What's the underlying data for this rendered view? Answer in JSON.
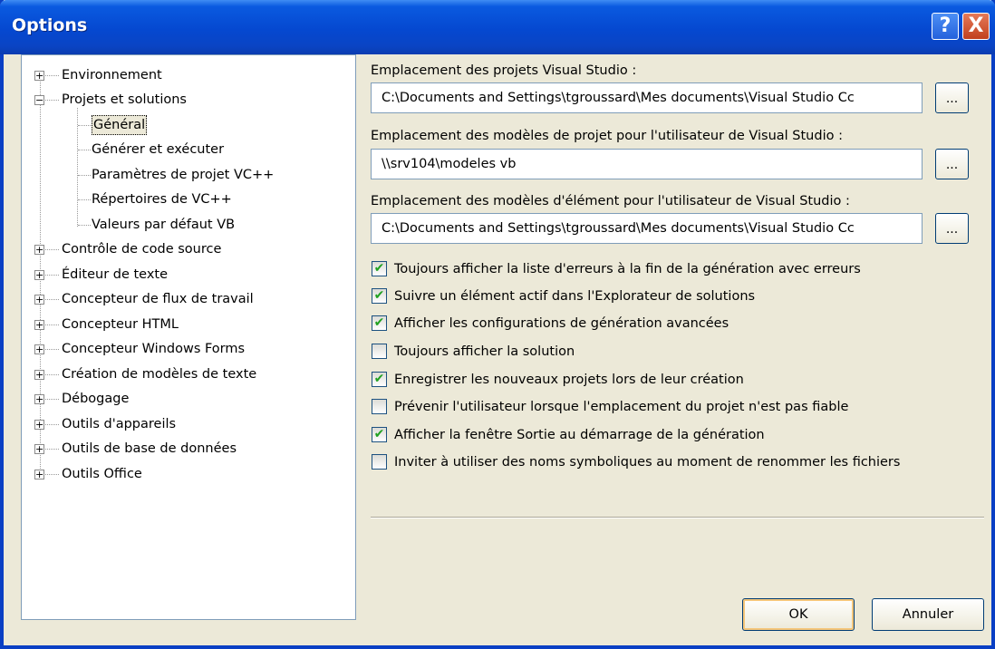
{
  "window": {
    "title": "Options"
  },
  "titlebar_buttons": {
    "help": "?",
    "close": "X"
  },
  "tree": {
    "top_items": [
      {
        "label": "Environnement",
        "expander": "+"
      },
      {
        "label": "Projets et solutions",
        "expander": "−"
      },
      {
        "label": "Contrôle de code source",
        "expander": "+"
      },
      {
        "label": "Éditeur de texte",
        "expander": "+"
      },
      {
        "label": "Concepteur de flux de travail",
        "expander": "+"
      },
      {
        "label": "Concepteur HTML",
        "expander": "+"
      },
      {
        "label": "Concepteur Windows Forms",
        "expander": "+"
      },
      {
        "label": "Création de modèles de texte",
        "expander": "+"
      },
      {
        "label": "Débogage",
        "expander": "+"
      },
      {
        "label": "Outils d'appareils",
        "expander": "+"
      },
      {
        "label": "Outils de base de données",
        "expander": "+"
      },
      {
        "label": "Outils Office",
        "expander": "+"
      }
    ],
    "children": [
      {
        "label": "Général"
      },
      {
        "label": "Générer et exécuter"
      },
      {
        "label": "Paramètres de projet VC++"
      },
      {
        "label": "Répertoires de VC++"
      },
      {
        "label": "Valeurs par défaut VB"
      }
    ],
    "selected": "Général"
  },
  "fields": [
    {
      "label": "Emplacement des projets Visual Studio :",
      "value": "C:\\Documents and Settings\\tgroussard\\Mes documents\\Visual Studio Cc",
      "browse": "..."
    },
    {
      "label": "Emplacement des modèles de projet pour l'utilisateur de Visual Studio :",
      "value": "\\\\srv104\\modeles vb",
      "browse": "..."
    },
    {
      "label": "Emplacement des modèles d'élément pour l'utilisateur de Visual Studio :",
      "value": "C:\\Documents and Settings\\tgroussard\\Mes documents\\Visual Studio Cc",
      "browse": "..."
    }
  ],
  "checkboxes": [
    {
      "label": "Toujours afficher la liste d'erreurs à la fin de la génération avec erreurs",
      "checked": true,
      "mark": "✔"
    },
    {
      "label": "Suivre un élément actif dans l'Explorateur de solutions",
      "checked": true,
      "mark": "✔"
    },
    {
      "label": "Afficher les configurations de génération avancées",
      "checked": true,
      "mark": "✔"
    },
    {
      "label": "Toujours afficher la solution",
      "checked": false,
      "mark": ""
    },
    {
      "label": "Enregistrer les nouveaux projets lors de leur création",
      "checked": true,
      "mark": "✔"
    },
    {
      "label": "Prévenir l'utilisateur lorsque l'emplacement du projet n'est pas fiable",
      "checked": false,
      "mark": ""
    },
    {
      "label": "Afficher la fenêtre Sortie au démarrage de la génération",
      "checked": true,
      "mark": "✔"
    },
    {
      "label": "Inviter à utiliser des noms symboliques au moment de renommer les fichiers",
      "checked": false,
      "mark": ""
    }
  ],
  "buttons": {
    "ok": "OK",
    "cancel": "Annuler"
  },
  "colors": {
    "titlebar": "#0548d0",
    "dialog_bg": "#ece9d8",
    "check": "#21a121"
  }
}
